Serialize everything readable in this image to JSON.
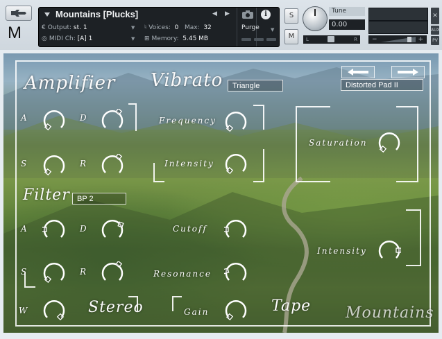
{
  "header": {
    "instrument_name": "Mountains [Plucks]",
    "output_label": "Output:",
    "output_value": "st. 1",
    "voices_label": "Voices:",
    "voices_value": "0",
    "max_label": "Max:",
    "max_value": "32",
    "purge_label": "Purge",
    "midi_label": "MIDI Ch:",
    "midi_value": "[A]  1",
    "memory_label": "Memory:",
    "memory_value": "5.45 MB",
    "s_label": "S",
    "m_label": "M",
    "tune_label": "Tune",
    "tune_value": "0.00",
    "pan_left": "L",
    "pan_right": "R",
    "vol_minus": "−",
    "vol_plus": "+",
    "aux_label": "AUX",
    "pv_label": "PV",
    "m_logo": "M"
  },
  "panel": {
    "amplifier_title": "Amplifier",
    "vibrato_title": "Vibrato",
    "vibrato_wave": "Triangle",
    "preset_name": "Distorted Pad II",
    "filter_title": "Filter",
    "filter_type": "BP 2",
    "amp_labels": [
      "A",
      "D",
      "S",
      "R"
    ],
    "filter_labels": [
      "A",
      "D",
      "S",
      "R"
    ],
    "w_label": "W",
    "frequency": "Frequency",
    "intensity_vib": "Intensity",
    "saturation": "Saturation",
    "cutoff": "Cutoff",
    "resonance": "Resonance",
    "intensity_sat": "Intensity",
    "stereo": "Stereo",
    "gain": "Gain",
    "tape": "Tape",
    "brand": "Mountains"
  }
}
